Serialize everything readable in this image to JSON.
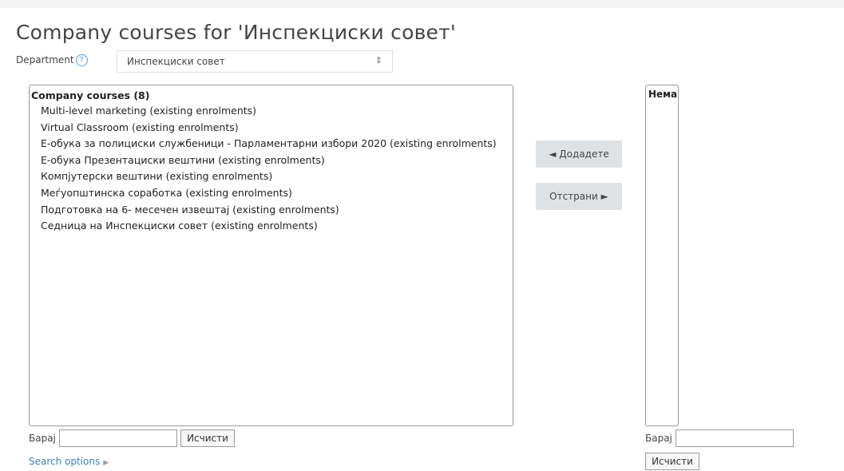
{
  "title": "Company courses for 'Инспекциски совет'",
  "department": {
    "label": "Department",
    "selected": "Инспекциски совет",
    "chevron": "⇕"
  },
  "left_list": {
    "group_label": "Company courses (8)",
    "options": [
      "Multi-level marketing (existing enrolments)",
      "Virtual Classroom (existing enrolments)",
      "Е-обука за полициски службеници - Парламентарни избори 2020 (existing enrolments)",
      "Е-обука Презентациски вештини (existing enrolments)",
      "Компјутерски вештини (existing enrolments)",
      "Меѓуопштинска соработка (existing enrolments)",
      "Подготовка на 6- месечен извештај (existing enrolments)",
      "Седница на Инспекциски совет (existing enrolments)"
    ]
  },
  "buttons": {
    "add": "◄ Додадете",
    "remove": "Отстрани ►"
  },
  "right_list": {
    "label": "Нема"
  },
  "search_left": {
    "label": "Барај",
    "value": "",
    "clear": "Исчисти"
  },
  "search_right": {
    "label": "Барај",
    "value": "",
    "clear": "Исчисти"
  },
  "search_options": "Search options"
}
